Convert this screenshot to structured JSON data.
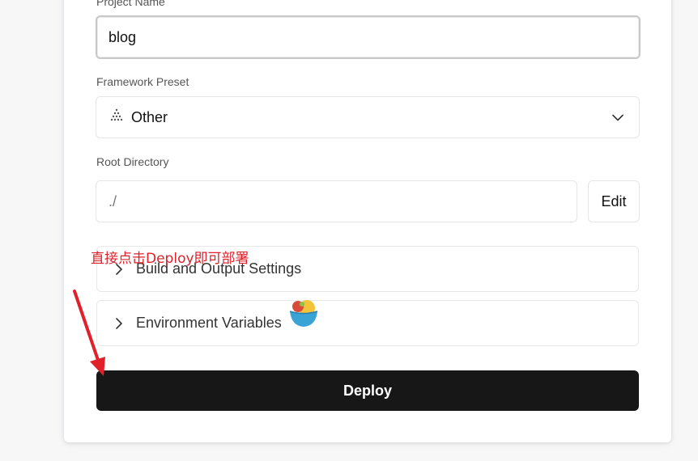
{
  "form": {
    "project_name": {
      "label": "Project Name",
      "value": "blog"
    },
    "framework_preset": {
      "label": "Framework Preset",
      "value": "Other",
      "icon": "triangle-dots-icon"
    },
    "root_directory": {
      "label": "Root Directory",
      "value": "./",
      "edit_label": "Edit"
    },
    "sections": [
      {
        "label": "Build and Output Settings",
        "expanded": false
      },
      {
        "label": "Environment Variables",
        "expanded": false
      }
    ],
    "deploy_label": "Deploy"
  },
  "annotation": {
    "text": "直接点击Deploy即可部署",
    "color": "#e0202a"
  },
  "colors": {
    "deploy_bg": "#171717",
    "card_bg": "#ffffff",
    "page_bg": "#f7f7f8"
  }
}
